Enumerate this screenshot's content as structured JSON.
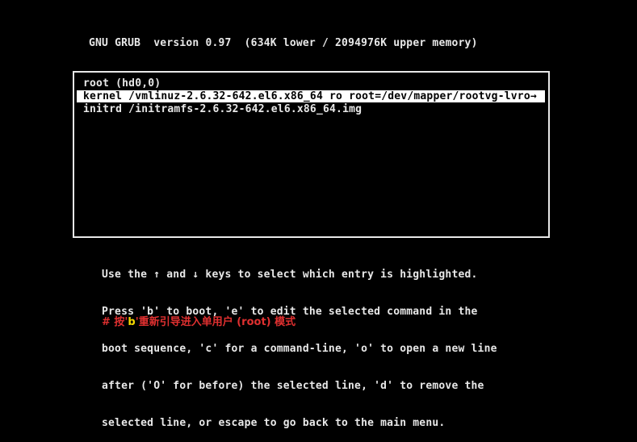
{
  "header": {
    "text": "GNU GRUB  version 0.97  (634K lower / 2094976K upper memory)"
  },
  "menu": {
    "entries": [
      {
        "text": "root (hd0,0)",
        "selected": false
      },
      {
        "text": "kernel /vmlinuz-2.6.32-642.el6.x86_64 ro root=/dev/mapper/rootvg-lvro→",
        "selected": true
      },
      {
        "text": "initrd /initramfs-2.6.32-642.el6.x86_64.img",
        "selected": false
      }
    ]
  },
  "help": {
    "lines": [
      "Use the ↑ and ↓ keys to select which entry is highlighted.",
      "Press 'b' to boot, 'e' to edit the selected command in the",
      "boot sequence, 'c' for a command-line, 'o' to open a new line",
      "after ('O' for before) the selected line, 'd' to remove the",
      "selected line, or escape to go back to the main menu."
    ]
  },
  "annotation": {
    "prefix": "# 按'",
    "key": "b",
    "suffix": "'重新引导进入单用户 (root) 模式"
  },
  "colors": {
    "background": "#000000",
    "foreground": "#e8e8e8",
    "highlight_bg": "#ffffff",
    "annotation": "#e03030",
    "annotation_key": "#f5d800"
  }
}
